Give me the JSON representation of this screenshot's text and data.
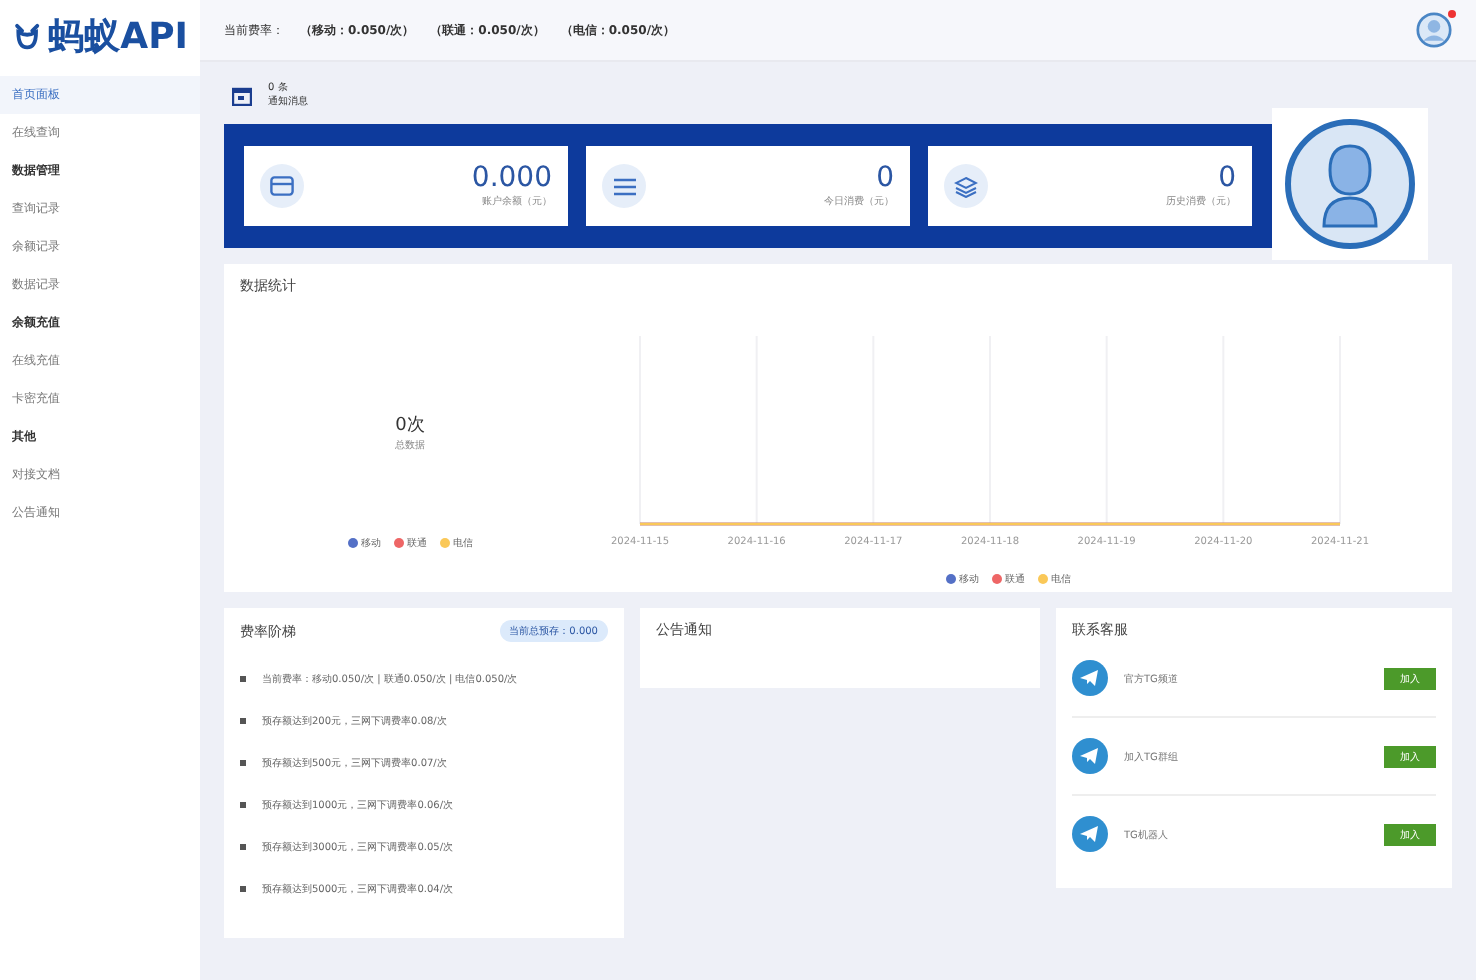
{
  "logo": {
    "text": "蚂蚁API"
  },
  "header": {
    "rates": [
      "当前费率：",
      "（移动：0.050/次）",
      "（联通：0.050/次）",
      "（电信：0.050/次）"
    ],
    "has_notification": true
  },
  "sidebar": {
    "items": [
      {
        "kind": "item",
        "label": "首页面板",
        "selected": true
      },
      {
        "kind": "item",
        "label": "在线查询",
        "selected": false
      },
      {
        "kind": "header",
        "label": "数据管理"
      },
      {
        "kind": "item",
        "label": "查询记录",
        "selected": false
      },
      {
        "kind": "item",
        "label": "余额记录",
        "selected": false
      },
      {
        "kind": "item",
        "label": "数据记录",
        "selected": false
      },
      {
        "kind": "header",
        "label": "余额充值"
      },
      {
        "kind": "item",
        "label": "在线充值",
        "selected": false
      },
      {
        "kind": "item",
        "label": "卡密充值",
        "selected": false
      },
      {
        "kind": "header",
        "label": "其他"
      },
      {
        "kind": "item",
        "label": "对接文档",
        "selected": false
      },
      {
        "kind": "item",
        "label": "公告通知",
        "selected": false
      }
    ]
  },
  "notice_bar": {
    "count": "0 条",
    "label": "通知消息"
  },
  "stats": [
    {
      "kind": "card",
      "value": "0.000",
      "label": "账户余额（元）"
    },
    {
      "kind": "list",
      "value": "0",
      "label": "今日消费（元）"
    },
    {
      "kind": "layers",
      "value": "0",
      "label": "历史消费（元）"
    }
  ],
  "data_stats": {
    "title": "数据统计",
    "total": "0次",
    "total_label": "总数据",
    "legend": [
      {
        "label": "移动",
        "color": "#5470c6"
      },
      {
        "label": "联通",
        "color": "#ee6666"
      },
      {
        "label": "电信",
        "color": "#fac858"
      }
    ],
    "x_labels": [
      "2024-11-15",
      "2024-11-16",
      "2024-11-17",
      "2024-11-18",
      "2024-11-19",
      "2024-11-20",
      "2024-11-21"
    ],
    "chart_legend": [
      {
        "label": "移动",
        "color": "#5470c6"
      },
      {
        "label": "联通",
        "color": "#ee6666"
      },
      {
        "label": "电信",
        "color": "#fac858"
      }
    ]
  },
  "rate_tiers": {
    "title": "费率阶梯",
    "badge": "当前总预存：0.000",
    "items": [
      "当前费率：移动0.050/次 | 联通0.050/次 | 电信0.050/次",
      "预存额达到200元，三网下调费率0.08/次",
      "预存额达到500元，三网下调费率0.07/次",
      "预存额达到1000元，三网下调费率0.06/次",
      "预存额达到3000元，三网下调费率0.05/次",
      "预存额达到5000元，三网下调费率0.04/次"
    ]
  },
  "announcements": {
    "title": "公告通知"
  },
  "contact": {
    "title": "联系客服",
    "items": [
      {
        "label": "官方TG频道",
        "button": "加入"
      },
      {
        "label": "加入TG群组",
        "button": "加入"
      },
      {
        "label": "TG机器人",
        "button": "加入"
      }
    ]
  }
}
